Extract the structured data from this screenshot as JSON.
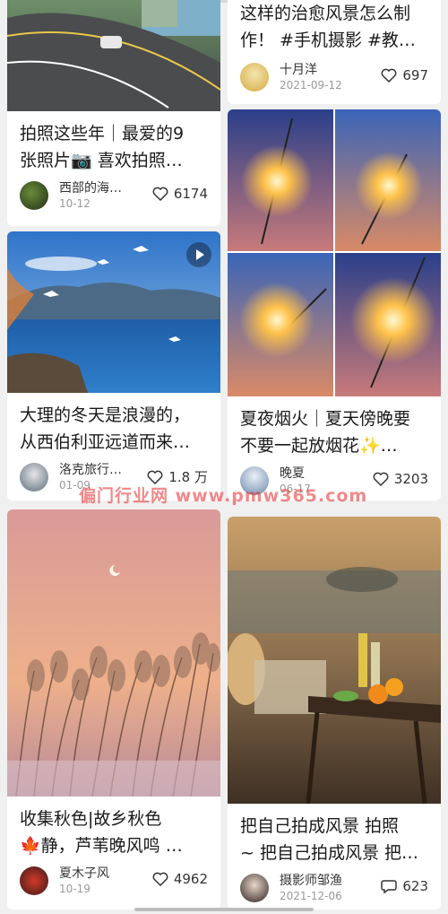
{
  "feed": {
    "watermark": "偏门行业网 www.pmw365.com",
    "cards": [
      {
        "title": "拍照这些年｜最爱的9\n张照片📷 喜欢拍照…",
        "author": "西部的海…",
        "date": "10-12",
        "likes": "6174"
      },
      {
        "title": "这样的治愈风景怎么制\n作！ #手机摄影 #教…",
        "author": "十月洋",
        "date": "2021-09-12",
        "likes": "697"
      },
      {
        "title": "大理的冬天是浪漫的，\n从西伯利亚远道而来…",
        "author": "洛克旅行…",
        "date": "01-09",
        "likes": "1.8 万",
        "video": true
      },
      {
        "title": "夏夜烟火｜夏天傍晚要\n不要一起放烟花✨…",
        "author": "晚夏",
        "date": "06-17",
        "likes": "3203"
      },
      {
        "title": "收集秋色|故乡秋色\n🍁静，芦苇晚风鸣 …",
        "author": "夏木子风",
        "date": "10-19",
        "likes": "4962"
      },
      {
        "title": "把自己拍成风景 拍照\n~ 把自己拍成风景 把…",
        "author": "摄影师邹渔",
        "date": "2021-12-06",
        "likes": "623"
      }
    ]
  }
}
